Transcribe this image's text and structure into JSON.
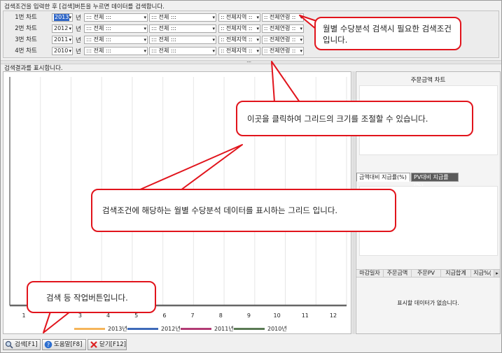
{
  "search_header": "검색조건을 입력한 후 [검색]버튼을 누르면 데이터를 검색합니다.",
  "rows": [
    {
      "label": "1번 차트",
      "year": "2013",
      "field1": "::: 전체 :::",
      "field2": "::: 전체 :::",
      "region": ":: 전체지역 ::",
      "age": ":: 전체연령 ::"
    },
    {
      "label": "2번 차트",
      "year": "2012",
      "field1": "::: 전체 :::",
      "field2": "::: 전체 :::",
      "region": ":: 전체지역 ::",
      "age": ":: 전체연령 ::"
    },
    {
      "label": "3번 차트",
      "year": "2011",
      "field1": "::: 전체 :::",
      "field2": "::: 전체 :::",
      "region": ":: 전체지역 ::",
      "age": ":: 전체연령 ::"
    },
    {
      "label": "4번 차트",
      "year": "2010",
      "field1": "::: 전체 :::",
      "field2": "::: 전체 :::",
      "region": ":: 전체지역 ::",
      "age": ":: 전체연령 ::"
    }
  ],
  "year_suffix": "년",
  "results_header": "검색결과를 표시합니다.",
  "grid_handle": "....",
  "chart": {
    "x_ticks": [
      "1",
      "2",
      "3",
      "4",
      "5",
      "6",
      "7",
      "8",
      "9",
      "10",
      "11",
      "12"
    ],
    "legend": [
      {
        "label": "2013년",
        "color": "#f5b55a"
      },
      {
        "label": "2012년",
        "color": "#3e6ab9"
      },
      {
        "label": "2011년",
        "color": "#b23b74"
      },
      {
        "label": "2010년",
        "color": "#5a7a54"
      }
    ]
  },
  "right_panel": {
    "title": "주문금액 차트",
    "tab_active": "금액대비 지급률(%)",
    "tab_inactive": "PV대비 지급률(%)",
    "columns": [
      "마감일자",
      "주문금액",
      "주문PV",
      "지급합계",
      "지급%("
    ],
    "empty_message": "표시할 데이터가 없습니다."
  },
  "buttons": {
    "search": "검색[F1]",
    "help": "도움말[F8]",
    "close": "닫기[F12]"
  },
  "callouts": {
    "conditions": "월별 수당분석 검색시 필요한 검색조건입니다.",
    "resize": "이곳을 클릭하여 그리드의 크기를 조절할 수 있습니다.",
    "grid": "검색조건에 해당하는 월별 수당분석 데이터를 표시하는 그리드 입니다.",
    "buttons": "검색 등 작업버튼입니다."
  }
}
